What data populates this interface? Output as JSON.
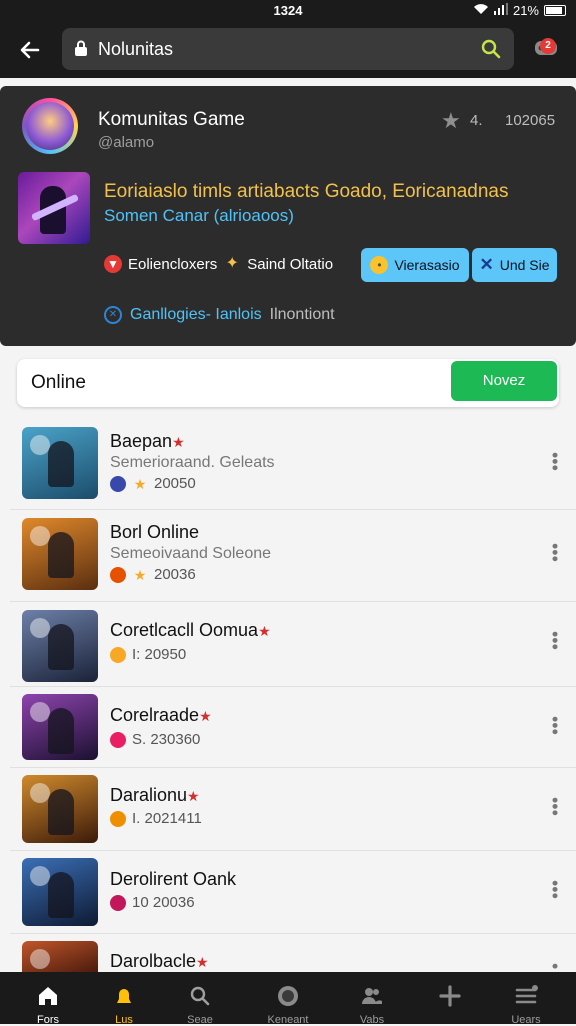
{
  "status_bar": {
    "time": "1324",
    "battery": "21%"
  },
  "top_bar": {
    "search_query": "Nolunitas",
    "notification_count": "2"
  },
  "community": {
    "name": "Komunitas Game",
    "handle": "@alamo",
    "rating": "4.",
    "members": "102065",
    "feature_title": "Eoriaiaslo timls artiabacts Goado, Eoricanadnas",
    "feature_subtitle": "Somen Canar (alrioaoos)",
    "chip_1": "Eoliencloxers",
    "chip_2": "Saind Oltatio",
    "pill_1": "Vierasasio",
    "pill_2": "Und Sie",
    "info_text_1": "Ganllogies- Ianlois",
    "info_text_2": "Ilnontiont"
  },
  "online_section": {
    "title": "Online",
    "button": "Novez"
  },
  "games": [
    {
      "title": "Baepan",
      "subtitle": "Semerioraand. Geleats",
      "meta": "20050",
      "thumb": "#4aa3c9",
      "thumb2": "#1c4c6b",
      "meta_ico": "#3949ab",
      "meta_ico2": "#f9a825",
      "star": true
    },
    {
      "title": "Borl Online",
      "subtitle": "Semeoivaand Soleone",
      "meta": "20036",
      "thumb": "#e0892b",
      "thumb2": "#5a2e10",
      "meta_ico": "#e65100",
      "meta_ico2": "#f9a825",
      "star": false
    },
    {
      "title": "Coretlcacll Oomua",
      "subtitle": "",
      "meta": "I: 20950",
      "thumb": "#6d80a8",
      "thumb2": "#1a2238",
      "meta_ico": "#f9a825",
      "meta_ico2": "",
      "star": true
    },
    {
      "title": "Corelraade",
      "subtitle": "",
      "meta": "S. 230360",
      "thumb": "#8e44ad",
      "thumb2": "#1b1030",
      "meta_ico": "#e91e63",
      "meta_ico2": "",
      "star": true
    },
    {
      "title": "Daralionu",
      "subtitle": "",
      "meta": "I. 2021411",
      "thumb": "#d08a2c",
      "thumb2": "#3b1a0a",
      "meta_ico": "#ef8f00",
      "meta_ico2": "",
      "star": true
    },
    {
      "title": "Derolirent Oank",
      "subtitle": "",
      "meta": "10 20036",
      "thumb": "#3b6fb6",
      "thumb2": "#0e1a33",
      "meta_ico": "#c2185b",
      "meta_ico2": "",
      "star": false
    },
    {
      "title": "Darolbacle",
      "subtitle": "",
      "meta": "",
      "thumb": "#c0562a",
      "thumb2": "#3a1208",
      "meta_ico": "",
      "meta_ico2": "",
      "star": true
    }
  ],
  "bottom_nav": [
    "Fors",
    "Lus",
    "Seae",
    "Keneant",
    "Vabs",
    "",
    "Uears"
  ]
}
